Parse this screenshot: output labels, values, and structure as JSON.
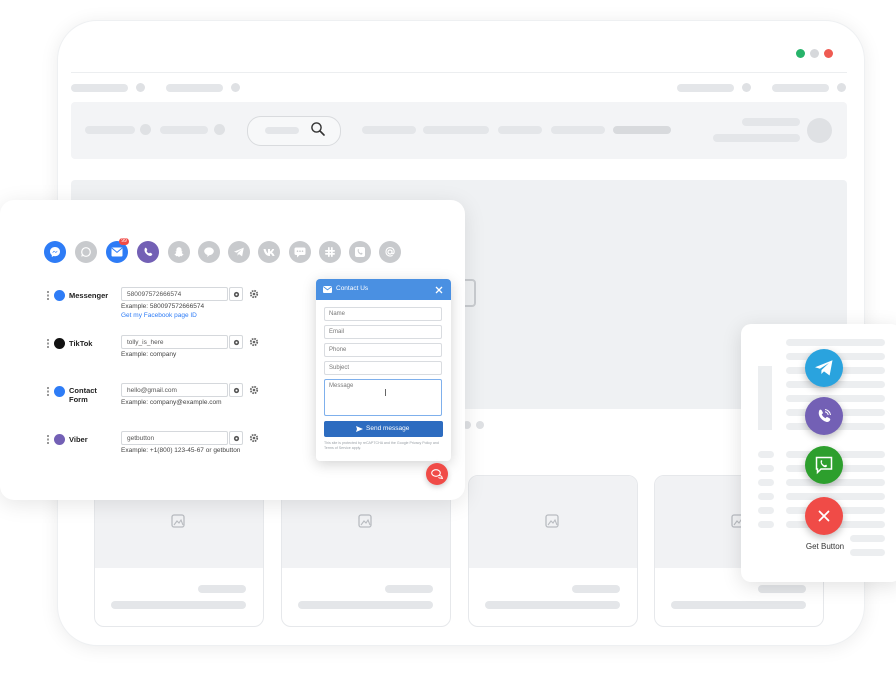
{
  "colors": {
    "accent": "#2e7cf6",
    "form_header": "#4a90e2",
    "send_button": "#2d6cc0",
    "telegram": "#2aa3de",
    "viber": "#7360b5",
    "whatsapp_green": "#2d9f2d",
    "close_red": "#f04b47",
    "dot_green": "#27b36a",
    "dot_grey": "#d6d8db",
    "dot_red": "#ef5b52"
  },
  "channel_bar": {
    "icons": [
      "messenger-icon",
      "whatsapp-icon",
      "email-icon",
      "viber-icon",
      "snapchat-icon",
      "line-icon",
      "telegram-icon",
      "vk-icon",
      "sms-icon",
      "slack-icon",
      "call-icon",
      "mail-at-icon"
    ],
    "email_badge": "99"
  },
  "channels": [
    {
      "label": "Messenger",
      "value": "580097572666574",
      "example": "Example: 580097572666574",
      "link": "Get my Facebook page ID",
      "icon": "messenger-icon"
    },
    {
      "label": "TikTok",
      "value": "tolly_is_here",
      "example": "Example: company",
      "icon": "tiktok-icon"
    },
    {
      "label": "Contact Form",
      "value": "hello@gmail.com",
      "example": "Example: company@example.com",
      "icon": "contact-form-icon"
    },
    {
      "label": "Viber",
      "value": "getbutton",
      "example": "Example: +1(800) 123-45-67 or getbutton",
      "icon": "viber-icon"
    }
  ],
  "contact_form": {
    "title": "Contact Us",
    "fields": [
      "Name",
      "Email",
      "Phone",
      "Subject"
    ],
    "message_placeholder": "Message",
    "submit_label": "Send message",
    "recaptcha_text": "This site is protected by reCAPTCHA and the Google Privacy Policy and Terms of Service apply."
  },
  "widget": {
    "label": "Get Button",
    "buttons": [
      "telegram-icon",
      "viber-icon",
      "whatsapp-icon",
      "close-icon"
    ]
  }
}
